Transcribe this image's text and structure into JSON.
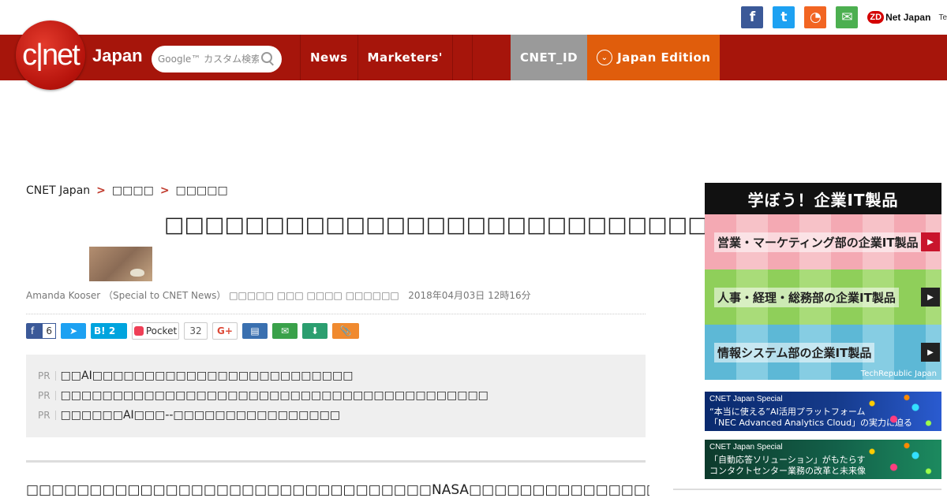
{
  "social": {
    "fb": "f",
    "tw": "t",
    "rss": "◔",
    "mail": "✉",
    "zdnet": "Net Japan",
    "zdnet_mark": "ZD",
    "techrepublic": "Te"
  },
  "header": {
    "logo": "c|net",
    "logo_suffix": "Japan",
    "search_placeholder": "Google™ カスタム検索",
    "nav": [
      "News",
      "Marketers'"
    ],
    "cnet_id": "CNET_ID",
    "edition": "Japan Edition"
  },
  "breadcrumb": {
    "home": "CNET Japan",
    "section": "□□□□",
    "subsection": "□□□□□"
  },
  "article": {
    "headline": "□□□□□□□□□□□□□□□□□□□□□□□□□□□□□□□□□NASA□□",
    "byline": "Amanda Kooser （Special to CNET News） □□□□□ □□□ □□□□ □□□□□□",
    "date": "2018年04月03日 12時16分",
    "body_start": "□□□□□□□□□□□□□□□□□□□□□□□□□□□□□□□□NASA□□□□□□□□□□□□□□□□"
  },
  "share": {
    "fb_count": "6",
    "hatena_label": "B!",
    "hatena_count": "2",
    "pocket_label": "Pocket",
    "pocket_count": "32",
    "gplus": "G+"
  },
  "pr": [
    {
      "tag": "PR",
      "text": "□□AI□□□□□□□□□□□□□□□□□□□□□□□□□"
    },
    {
      "tag": "PR",
      "text": "□□□□□□□□□□□□□□□□□□□□□□□□□□□□□□□□□□□□□□□□□"
    },
    {
      "tag": "PR",
      "text": "□□□□□□AI□□□--□□□□□□□□□□□□□□□□"
    }
  ],
  "sidebar": {
    "learn_title": "学ぼう！企業IT製品",
    "bands": [
      "営業・マーケティング部の企業IT製品",
      "人事・経理・総務部の企業IT製品",
      "情報システム部の企業IT製品"
    ],
    "band_credit": "TechRepublic Japan",
    "ads": [
      {
        "kicker": "CNET Japan Special",
        "line1": "“本当に使える”AI活用プラットフォーム",
        "line2": "「NEC Advanced Analytics Cloud」の実力に迫る"
      },
      {
        "kicker": "CNET Japan Special",
        "line1": "「自動応答ソリューション」がもたらす",
        "line2": "コンタクトセンター業務の改革と未来像"
      }
    ]
  }
}
